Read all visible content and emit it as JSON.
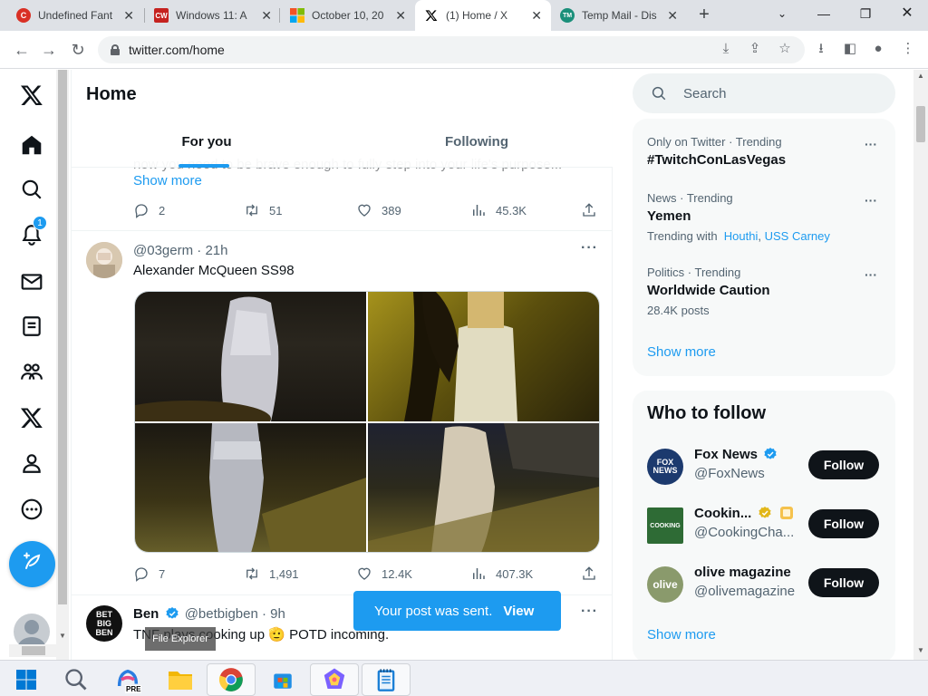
{
  "browser": {
    "tabs": [
      {
        "title": "Undefined Fant",
        "favicon": "C",
        "favicon_color": "#d93025",
        "active": false
      },
      {
        "title": "Windows 11: A",
        "favicon": "CW",
        "favicon_color": "#c5221f",
        "active": false
      },
      {
        "title": "October 10, 20",
        "favicon": "windows-logo",
        "favicon_color": "#f35325",
        "active": false
      },
      {
        "title": "(1) Home / X",
        "favicon": "X",
        "favicon_color": "#000000",
        "active": true
      },
      {
        "title": "Temp Mail - Dis",
        "favicon": "TM",
        "favicon_color": "#1a8f7a",
        "active": false
      }
    ],
    "url": "twitter.com/home"
  },
  "x": {
    "nav_badge": "1",
    "header": {
      "title": "Home",
      "tab_for_you": "For you",
      "tab_following": "Following"
    },
    "prev_tweet": {
      "cut_text": "now you need to be brave enough to fully step into your life's purpose...",
      "show_more": "Show more",
      "replies": "2",
      "reposts": "51",
      "likes": "389",
      "views": "45.3K"
    },
    "tweet1": {
      "handle": "@03germ",
      "time": "21h",
      "text": "Alexander McQueen SS98",
      "replies": "7",
      "reposts": "1,491",
      "likes": "12.4K",
      "views": "407.3K"
    },
    "tweet2": {
      "name": "Ben",
      "handle": "@betbigben",
      "time": "9h",
      "text": "TNF plays cooking up 🫡 POTD incoming.",
      "avatar_text": "BET BIG BEN"
    },
    "toast": {
      "text": "Your post was sent.",
      "action": "View"
    },
    "search_placeholder": "Search",
    "trends": [
      {
        "meta": "Only on Twitter · Trending",
        "topic": "#TwitchConLasVegas"
      },
      {
        "meta": "News · Trending",
        "topic": "Yemen",
        "sub_prefix": "Trending with",
        "sub_links": [
          "Houthi",
          "USS Carney"
        ]
      },
      {
        "meta": "Politics · Trending",
        "topic": "Worldwide Caution",
        "sub": "28.4K posts"
      }
    ],
    "trends_show_more": "Show more",
    "who_to_follow": {
      "title": "Who to follow",
      "accounts": [
        {
          "name": "Fox News",
          "handle": "@FoxNews",
          "avatar": "FOX NEWS",
          "button": "Follow"
        },
        {
          "name": "Cookin...",
          "handle": "@CookingCha...",
          "avatar": "COOKING",
          "button": "Follow"
        },
        {
          "name": "olive magazine",
          "handle": "@olivemagazine",
          "avatar": "olive",
          "button": "Follow"
        }
      ],
      "show_more": "Show more"
    }
  },
  "taskbar": {
    "tooltip": "File Explorer",
    "copilot_badge": "PRE"
  }
}
